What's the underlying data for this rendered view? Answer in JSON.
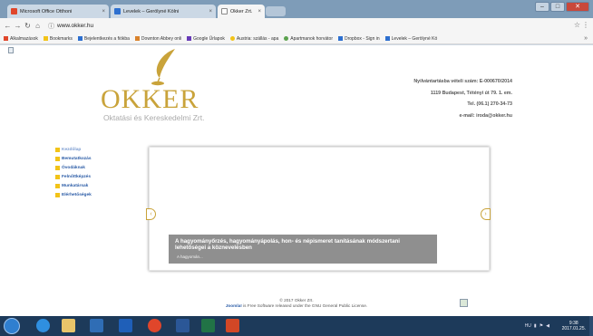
{
  "browser": {
    "tabs": [
      {
        "label": "Microsoft Office Otthoni",
        "icon": "office-icon",
        "icon_color": "#e0462b"
      },
      {
        "label": "Levelek – Gerölyné Kölni",
        "icon": "mail-icon",
        "icon_color": "#2d6fcf"
      },
      {
        "label": "Okker Zrt.",
        "icon": "page-icon",
        "icon_color": "#888888",
        "active": true
      }
    ],
    "url": "www.okker.hu",
    "bookmarks": [
      {
        "label": "Alkalmazások",
        "color": "#e0462b"
      },
      {
        "label": "Bookmarks",
        "color": "#f2c318"
      },
      {
        "label": "Bejelentkezés a fiókba",
        "color": "#2d6fcf"
      },
      {
        "label": "Downton Abbey onli",
        "color": "#d9822b"
      },
      {
        "label": "Google Űrlapok",
        "color": "#673ab7"
      },
      {
        "label": "Austria: szállás - apa",
        "color": "#f2c318"
      },
      {
        "label": "Apartmanok horvátor",
        "color": "#5ba24e"
      },
      {
        "label": "Dropbox - Sign in",
        "color": "#2d6fcf"
      },
      {
        "label": "Levelek – Gerölyné Kö",
        "color": "#2d6fcf"
      }
    ]
  },
  "site": {
    "logo_name": "OKKER",
    "logo_subtitle": "Oktatási és Kereskedelmi Zrt.",
    "brand_color": "#c9a33a",
    "contact": [
      "Nyilvántartásba vételi szám: E-000670/2014",
      "1119 Budapest, Tétényi út 79. 1. em.",
      "Tel.  (06.1) 270-34-73",
      "e-mail: iroda@okker.hu"
    ],
    "menu": [
      "Kezdőlap",
      "Bemutatkozás",
      "Óvodáknak",
      "Felnőttképzés",
      "Munkatársak",
      "Elérhetőségek"
    ],
    "slide": {
      "title": "A hagyományőrzés, hagyományápolás, hon- és népismeret tanításának módszertani lehetőségei a köznevelésben",
      "link": "A hagyomán..."
    },
    "footer": {
      "copyright": "© 2017 Okker Zrt.",
      "joomla_link": "Joomla!",
      "joomla_text": " is Free Software released under the GNU General Public License."
    }
  },
  "taskbar": {
    "apps": [
      {
        "name": "ie-icon",
        "color": "#2f8fe0"
      },
      {
        "name": "explorer-icon",
        "color": "#e8c46a"
      },
      {
        "name": "media-icon",
        "color": "#2f6db5"
      },
      {
        "name": "outlook-icon",
        "color": "#1f5fb8"
      },
      {
        "name": "chrome-icon",
        "color": "#e0462b"
      },
      {
        "name": "word-icon",
        "color": "#2b5797"
      },
      {
        "name": "excel-icon",
        "color": "#217346"
      },
      {
        "name": "powerpoint-icon",
        "color": "#d24726"
      }
    ],
    "tray_lang": "HU",
    "clock_time": "9:38",
    "clock_date": "2017.01.25."
  }
}
